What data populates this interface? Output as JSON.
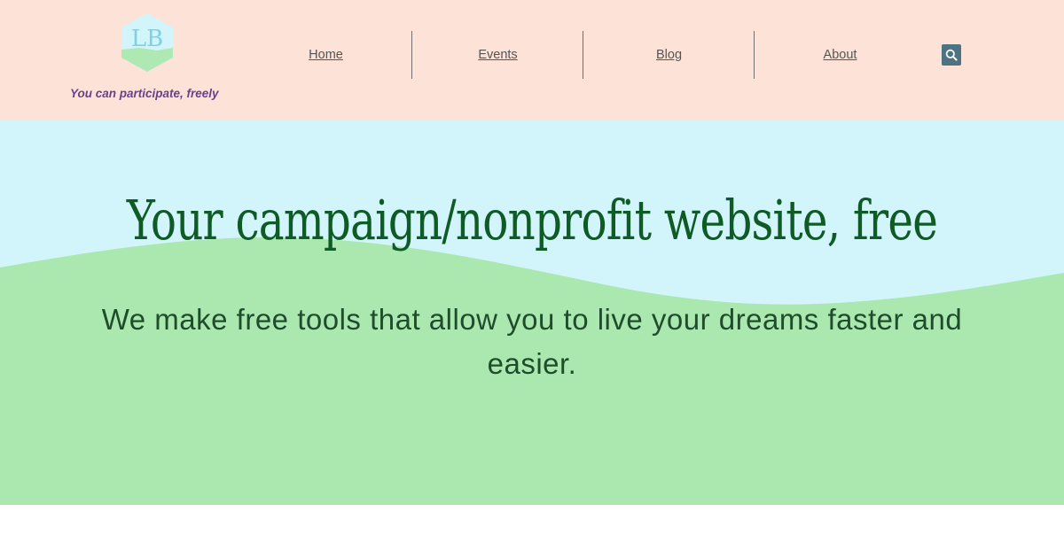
{
  "brand": {
    "logo_text": "LB",
    "tagline": "You can participate, freely",
    "logo_top_color": "#d2f5fc",
    "logo_bottom_color": "#aee8b2",
    "logo_text_color": "#7fd0e6"
  },
  "nav": {
    "items": [
      {
        "label": "Home"
      },
      {
        "label": "Events"
      },
      {
        "label": "Blog"
      },
      {
        "label": "About"
      }
    ],
    "search_icon": "search-icon"
  },
  "hero": {
    "title": "Your campaign/nonprofit website, free",
    "subtitle": "We make free tools that allow you to live your dreams faster and easier."
  },
  "colors": {
    "header_bg": "#fde3d7",
    "hero_sky": "#d2f5fc",
    "hero_hill": "#abe8b0",
    "title_color": "#0f5b26",
    "subtitle_color": "#1f4d2b",
    "tagline_color": "#6b3f8e",
    "search_button_bg": "#4d7383"
  }
}
